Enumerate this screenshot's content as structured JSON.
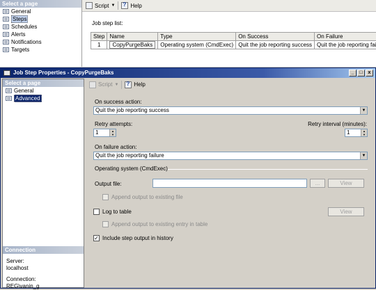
{
  "background_window": {
    "page_header": "Select a page",
    "pages": [
      "General",
      "Steps",
      "Schedules",
      "Alerts",
      "Notifications",
      "Targets"
    ],
    "selected_page": "Steps",
    "toolbar": {
      "script": "Script",
      "help": "Help"
    },
    "job_step_list_label": "Job step list:",
    "table": {
      "headers": [
        "Step",
        "Name",
        "Type",
        "On Success",
        "On Failure"
      ],
      "rows": [
        [
          "1",
          "CopyPurgeBaks",
          "Operating system (CmdExec)",
          "Quit the job reporting success",
          "Quit the job reporting failure"
        ]
      ]
    }
  },
  "dialog": {
    "title": "Job Step Properties - CopyPurgeBaks",
    "window_buttons": {
      "minimize": "_",
      "maximize": "□",
      "close": "x"
    },
    "page_header": "Select a page",
    "pages": [
      "General",
      "Advanced"
    ],
    "selected_page": "Advanced",
    "toolbar": {
      "script": "Script",
      "help": "Help"
    },
    "connection": {
      "header": "Connection",
      "server_label": "Server:",
      "server_value": "localhost",
      "connection_label": "Connection:",
      "connection_value": "REG\\vanin_g"
    },
    "on_success_label": "On success action:",
    "on_success_value": "Quit the job reporting success",
    "retry_attempts_label": "Retry attempts:",
    "retry_attempts_value": "1",
    "retry_interval_label": "Retry interval (minutes):",
    "retry_interval_value": "1",
    "on_failure_label": "On failure action:",
    "on_failure_value": "Quit the job reporting failure",
    "section_os": "Operating system (CmdExec)",
    "output_file_label": "Output file:",
    "output_file_value": "",
    "browse_label": "...",
    "view_label": "View",
    "append_output_label": "Append output to existing file",
    "log_to_table_label": "Log to table",
    "view2_label": "View",
    "append_entry_label": "Append output to existing entry in table",
    "include_history_label": "Include step output in history",
    "include_history_checked": true
  }
}
